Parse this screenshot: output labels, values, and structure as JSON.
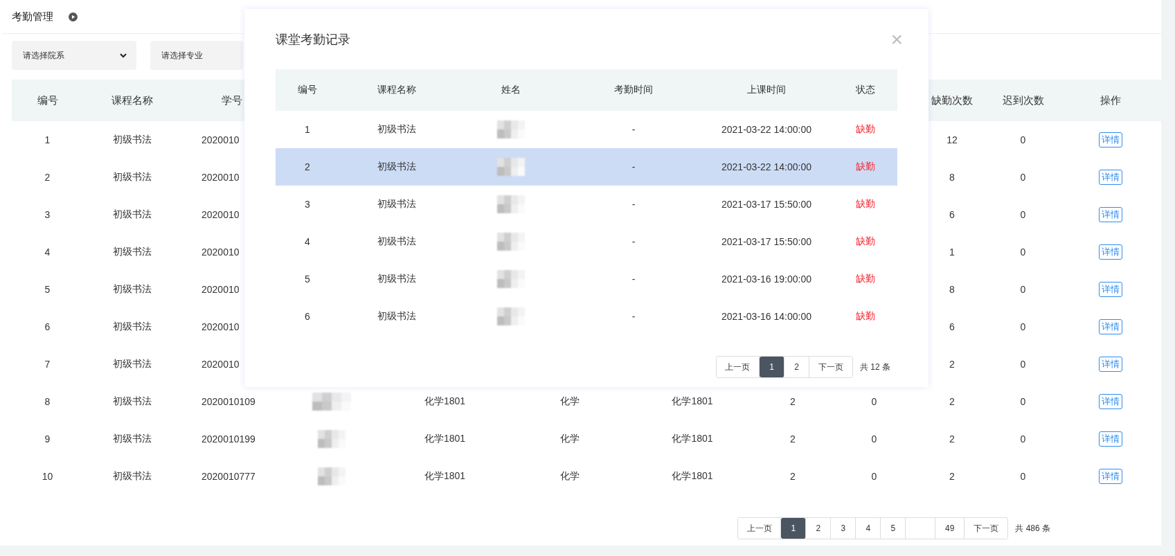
{
  "header": {
    "title": "考勤管理"
  },
  "filters": [
    {
      "placeholder": "请选择院系",
      "chevron": true
    },
    {
      "placeholder": "请选择专业",
      "chevron": false
    }
  ],
  "table": {
    "columns": [
      "编号",
      "课程名称",
      "学号",
      null,
      null,
      null,
      null,
      null,
      null,
      "缺勤次数",
      "迟到次数",
      "操作"
    ],
    "rows": [
      {
        "cells": [
          "1",
          "初级书法",
          "2020010",
          null,
          null,
          null,
          null,
          null,
          null,
          "12",
          "0"
        ],
        "action": "详情"
      },
      {
        "cells": [
          "2",
          "初级书法",
          "2020010",
          null,
          null,
          null,
          null,
          null,
          null,
          "8",
          "0"
        ],
        "action": "详情"
      },
      {
        "cells": [
          "3",
          "初级书法",
          "2020010",
          null,
          null,
          null,
          null,
          null,
          null,
          "6",
          "0"
        ],
        "action": "详情"
      },
      {
        "cells": [
          "4",
          "初级书法",
          "2020010",
          null,
          null,
          null,
          null,
          null,
          null,
          "1",
          "0"
        ],
        "action": "详情"
      },
      {
        "cells": [
          "5",
          "初级书法",
          "2020010",
          null,
          null,
          null,
          null,
          null,
          null,
          "8",
          "0"
        ],
        "action": "详情"
      },
      {
        "cells": [
          "6",
          "初级书法",
          "2020010",
          null,
          null,
          null,
          null,
          null,
          null,
          "6",
          "0"
        ],
        "action": "详情"
      },
      {
        "cells": [
          "7",
          "初级书法",
          "2020010",
          null,
          null,
          null,
          null,
          null,
          null,
          "2",
          "0"
        ],
        "action": "详情"
      },
      {
        "cells": [
          "8",
          "初级书法",
          "2020010109",
          null,
          "化学1801",
          "化学",
          "化学1801",
          "2",
          "0",
          "2",
          "0"
        ],
        "action": "详情",
        "blurred_name": true
      },
      {
        "cells": [
          "9",
          "初级书法",
          "2020010199",
          null,
          "化学1801",
          "化学",
          "化学1801",
          "2",
          "0",
          "2",
          "0"
        ],
        "action": "详情",
        "blurred_name": true
      },
      {
        "cells": [
          "10",
          "初级书法",
          "2020010777",
          null,
          "化学1801",
          "化学",
          "化学1801",
          "2",
          "0",
          "2",
          "0"
        ],
        "action": "详情",
        "blurred_name": true
      }
    ]
  },
  "pagination": {
    "prev": "上一页",
    "pages": [
      {
        "label": "1",
        "selected": true
      },
      {
        "label": "2",
        "selected": false
      },
      {
        "label": "3",
        "selected": false
      },
      {
        "label": "4",
        "selected": false
      },
      {
        "label": "5",
        "selected": false
      }
    ],
    "last_page": "49",
    "next": "下一页",
    "total": "共 486 条"
  },
  "modal": {
    "title": "课堂考勤记录",
    "close": "×",
    "columns": [
      "编号",
      "课程名称",
      "姓名",
      "考勤时间",
      "上课时间",
      "状态"
    ],
    "rows": [
      {
        "id": "1",
        "course": "初级书法",
        "check_time": "-",
        "class_time": "2021-03-22 14:00:00",
        "status": "缺勤",
        "selected": false
      },
      {
        "id": "2",
        "course": "初级书法",
        "check_time": "-",
        "class_time": "2021-03-22 14:00:00",
        "status": "缺勤",
        "selected": true
      },
      {
        "id": "3",
        "course": "初级书法",
        "check_time": "-",
        "class_time": "2021-03-17 15:50:00",
        "status": "缺勤",
        "selected": false
      },
      {
        "id": "4",
        "course": "初级书法",
        "check_time": "-",
        "class_time": "2021-03-17 15:50:00",
        "status": "缺勤",
        "selected": false
      },
      {
        "id": "5",
        "course": "初级书法",
        "check_time": "-",
        "class_time": "2021-03-16 19:00:00",
        "status": "缺勤",
        "selected": false
      },
      {
        "id": "6",
        "course": "初级书法",
        "check_time": "-",
        "class_time": "2021-03-16 14:00:00",
        "status": "缺勤",
        "selected": false
      }
    ],
    "pagination": {
      "prev": "上一页",
      "pages": [
        {
          "label": "1",
          "selected": true
        },
        {
          "label": "2",
          "selected": false
        }
      ],
      "next": "下一页",
      "total": "共 12 条"
    }
  }
}
